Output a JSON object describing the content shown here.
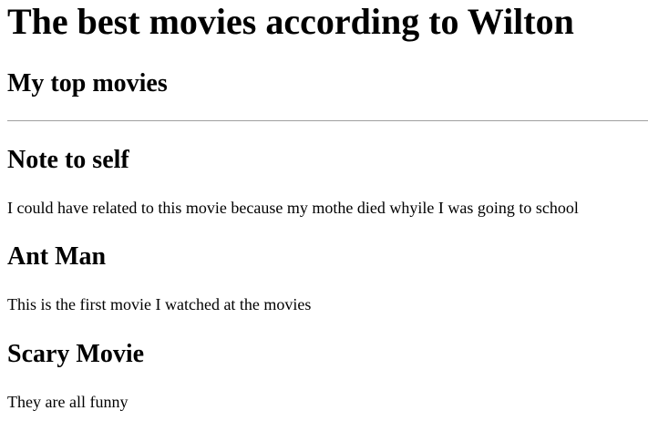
{
  "page": {
    "title": "The best movies according to Wilton",
    "subtitle": "My top movies"
  },
  "sections": [
    {
      "heading": "Note to self",
      "text": "I could have related to this movie because my mothe died whyile I was going to school"
    },
    {
      "heading": "Ant Man",
      "text": "This is the first movie I watched at the movies"
    },
    {
      "heading": "Scary Movie",
      "text": "They are all funny"
    }
  ]
}
